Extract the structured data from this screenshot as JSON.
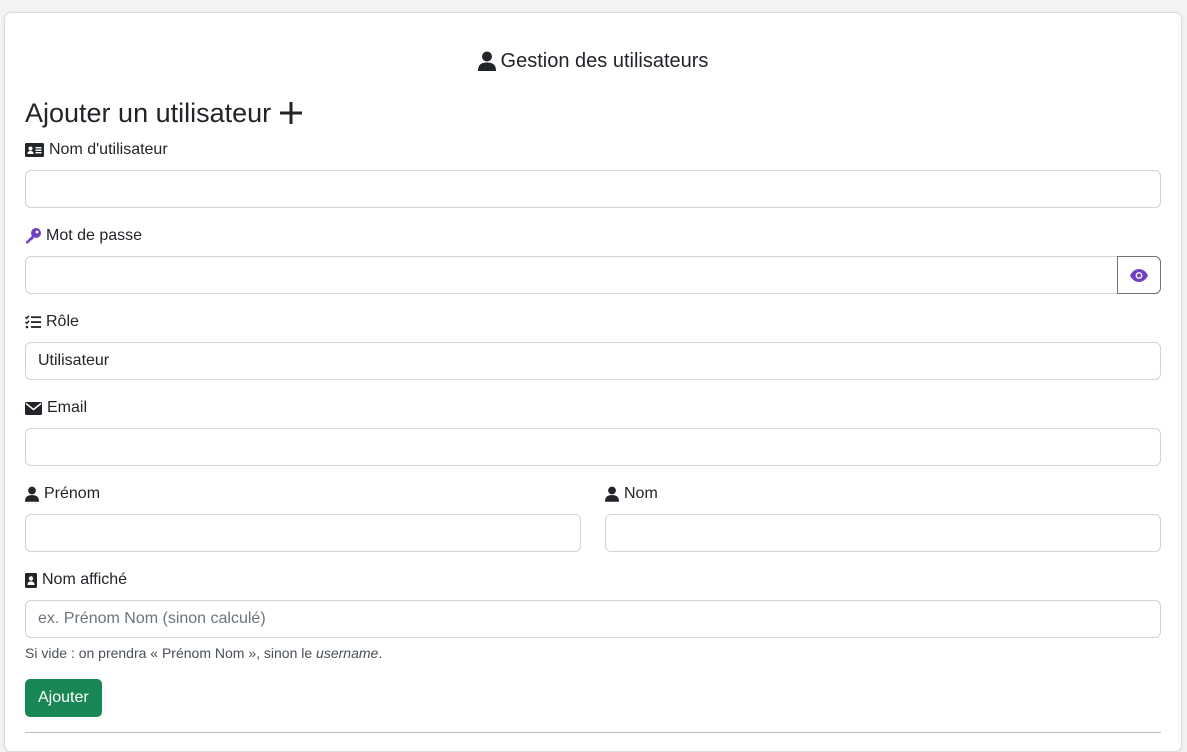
{
  "header": {
    "title": "Gestion des utilisateurs",
    "icon": "user-icon"
  },
  "form": {
    "title": "Ajouter un utilisateur",
    "title_icon": "plus-icon",
    "fields": {
      "username": {
        "label": "Nom d'utilisateur",
        "icon": "id-card-icon",
        "value": "",
        "placeholder": ""
      },
      "password": {
        "label": "Mot de passe",
        "icon": "key-icon",
        "value": "",
        "placeholder": "",
        "toggle_icon": "eye-icon"
      },
      "role": {
        "label": "Rôle",
        "icon": "list-check-icon",
        "value": "Utilisateur"
      },
      "email": {
        "label": "Email",
        "icon": "envelope-icon",
        "value": "",
        "placeholder": ""
      },
      "firstname": {
        "label": "Prénom",
        "icon": "user-icon",
        "value": "",
        "placeholder": ""
      },
      "lastname": {
        "label": "Nom",
        "icon": "user-icon",
        "value": "",
        "placeholder": ""
      },
      "display_name": {
        "label": "Nom affiché",
        "icon": "address-book-icon",
        "value": "",
        "placeholder": "ex. Prénom Nom (sinon calculé)"
      }
    },
    "help_text_prefix": "Si vide : on prendra « Prénom Nom », sinon le ",
    "help_text_em": "username",
    "help_text_suffix": ".",
    "submit_label": "Ajouter"
  },
  "colors": {
    "primary_text": "#212529",
    "accent_purple": "#6f42c1",
    "submit_green": "#198754",
    "border": "#ced4da"
  }
}
